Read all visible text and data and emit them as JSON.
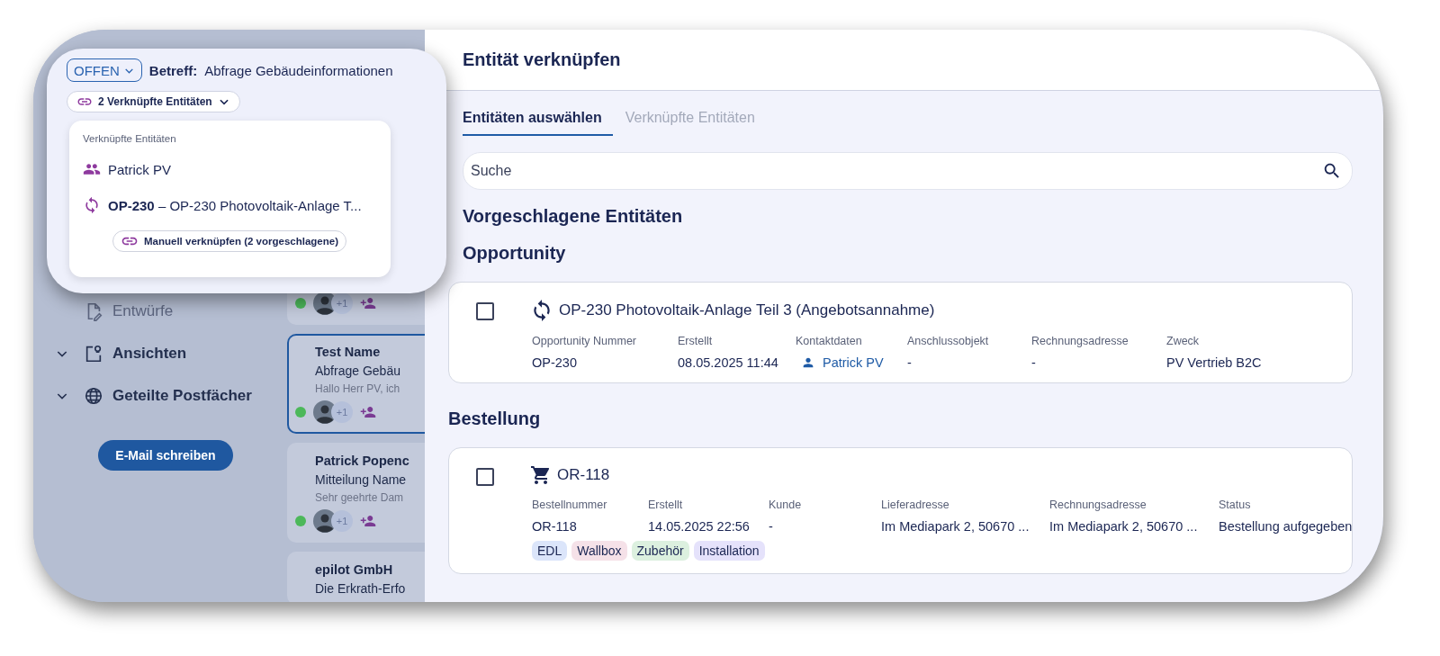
{
  "ticket": {
    "status": "OFFEN",
    "subject_label": "Betreff:",
    "subject": "Abfrage Gebäudeinformationen",
    "linked_chip": "2 Verknüpfte Entitäten",
    "dropdown": {
      "header": "Verknüpfte Entitäten",
      "items": [
        {
          "kind": "contact",
          "text": "Patrick PV"
        },
        {
          "kind": "opportunity",
          "id": "OP-230",
          "text": "– OP-230 Photovoltaik-Anlage T..."
        }
      ],
      "button": "Manuell verknüpfen (2 vorgeschlagene)"
    }
  },
  "sidebar": {
    "items": [
      {
        "kind": "drafts",
        "label": "Entwürfe",
        "disabled": true
      },
      {
        "kind": "views",
        "label": "Ansichten",
        "disabled": false
      },
      {
        "kind": "mailboxes",
        "label": "Geteilte Postfächer",
        "disabled": false
      }
    ],
    "compose_button": "E-Mail schreiben"
  },
  "mail_list": [
    {
      "extra": "+1",
      "selected": false
    },
    {
      "name": "Test Name",
      "subject": "Abfrage Gebäu",
      "preview": "Hallo Herr PV, ich",
      "extra": "+1",
      "selected": true
    },
    {
      "name": "Patrick Popenc",
      "subject": "Mitteilung Name",
      "preview": "Sehr geehrte Dam",
      "extra": "+1",
      "selected": false
    },
    {
      "name": "epilot GmbH",
      "subject": "Die Erkrath-Erfo",
      "selected": false
    }
  ],
  "panel": {
    "title": "Entität verknüpfen",
    "tabs": [
      {
        "label": "Entitäten auswählen",
        "selected": true
      },
      {
        "label": "Verknüpfte Entitäten",
        "selected": false
      }
    ],
    "search": {
      "placeholder": "Suche"
    },
    "suggested_heading": "Vorgeschlagene Entitäten",
    "sections": [
      {
        "heading": "Opportunity",
        "entities": [
          {
            "kind": "opportunity",
            "title": "OP-230 Photovoltaik-Anlage Teil 3 (Angebotsannahme)",
            "checked": false,
            "fields": [
              {
                "label": "Opportunity Nummer",
                "value": "OP-230",
                "kind": "text"
              },
              {
                "label": "Erstellt",
                "value": "08.05.2025 11:44",
                "kind": "text"
              },
              {
                "label": "Kontaktdaten",
                "value": "Patrick PV",
                "kind": "contact"
              },
              {
                "label": "Anschlussobjekt",
                "value": "-",
                "kind": "text"
              },
              {
                "label": "Rechnungsadresse",
                "value": "-",
                "kind": "text"
              },
              {
                "label": "Zweck",
                "value": "PV Vertrieb B2C",
                "kind": "text"
              }
            ]
          }
        ]
      },
      {
        "heading": "Bestellung",
        "entities": [
          {
            "kind": "order",
            "title": "OR-118",
            "checked": false,
            "fields": [
              {
                "label": "Bestellnummer",
                "value": "OR-118",
                "kind": "text"
              },
              {
                "label": "Erstellt",
                "value": "14.05.2025 22:56",
                "kind": "text"
              },
              {
                "label": "Kunde",
                "value": "-",
                "kind": "text"
              },
              {
                "label": "Lieferadresse",
                "value": "Im Mediapark 2, 50670 ...",
                "kind": "text"
              },
              {
                "label": "Rechnungsadresse",
                "value": "Im Mediapark 2, 50670 ...",
                "kind": "text"
              },
              {
                "label": "Status",
                "value": "Bestellung aufgegeben",
                "kind": "text"
              }
            ],
            "tags": [
              {
                "label": "EDL",
                "color": "#dbe5fa"
              },
              {
                "label": "Wallbox",
                "color": "#f5e1e8"
              },
              {
                "label": "Zubehör",
                "color": "#dcf0df"
              },
              {
                "label": "Installation",
                "color": "#e5e2fb"
              }
            ]
          }
        ]
      }
    ]
  }
}
